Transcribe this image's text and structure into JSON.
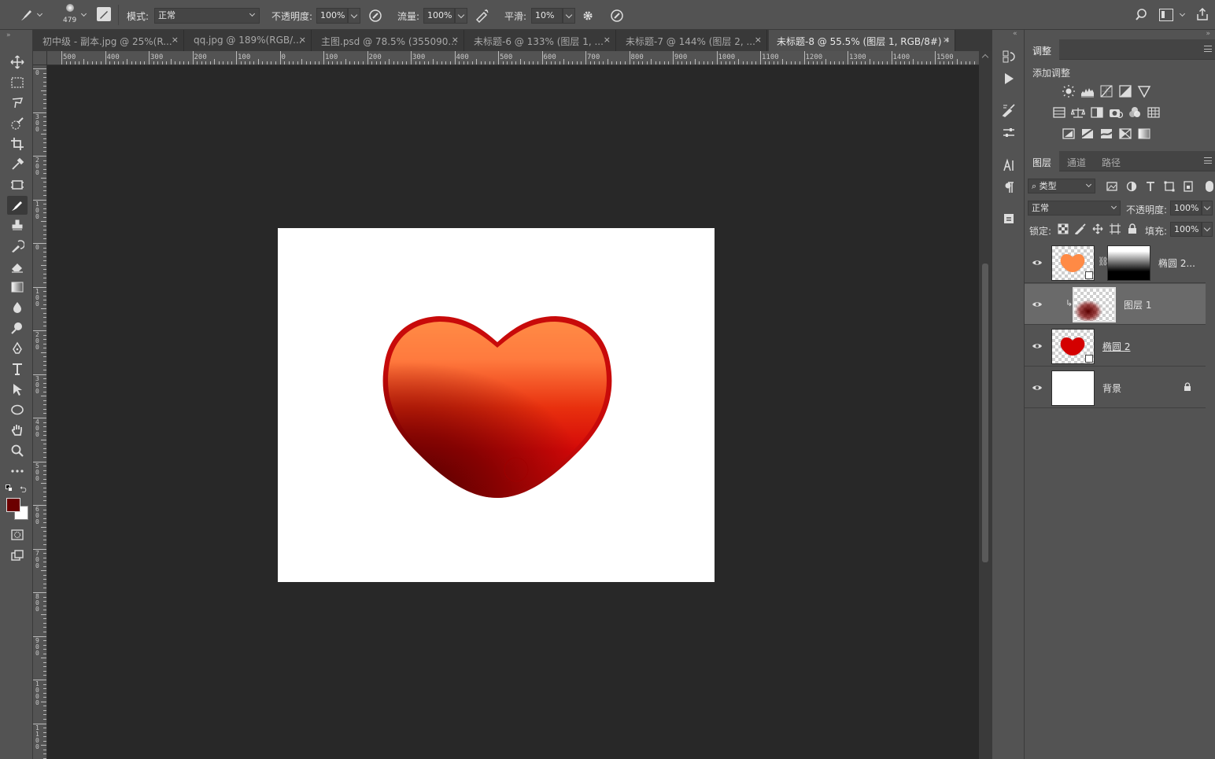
{
  "options_bar": {
    "brush_size": "479",
    "mode_label": "模式:",
    "mode_value": "正常",
    "opacity_label": "不透明度:",
    "opacity_value": "100%",
    "flow_label": "流量:",
    "flow_value": "100%",
    "smoothing_label": "平滑:",
    "smoothing_value": "10%"
  },
  "tabs": [
    {
      "label": "初中级 - 副本.jpg @ 25%(R...",
      "active": false
    },
    {
      "label": "qq.jpg @ 189%(RGB/...",
      "active": false
    },
    {
      "label": "主图.psd @ 78.5% (355090...",
      "active": false
    },
    {
      "label": "未标题-6 @ 133% (图层 1, ...",
      "active": false
    },
    {
      "label": "未标题-7 @ 144% (图层 2, ...",
      "active": false
    },
    {
      "label": "未标题-8 @ 55.5% (图层 1, RGB/8#) *",
      "active": true
    }
  ],
  "tab_close_glyph": "×",
  "ruler": {
    "h_labels": [
      "500",
      "400",
      "300",
      "200",
      "100",
      "0",
      "100",
      "200",
      "300",
      "400",
      "500",
      "600",
      "700",
      "800",
      "900",
      "1000",
      "1100",
      "1200",
      "1300",
      "1400",
      "1500"
    ],
    "v_labels": [
      "0",
      "300",
      "200",
      "100",
      "0",
      "100",
      "200",
      "300",
      "400",
      "500",
      "600",
      "700",
      "800",
      "900",
      "1000",
      "1100"
    ]
  },
  "colors": {
    "foreground": "#6b0000",
    "background": "#ffffff",
    "heart_top": "#ff8a45",
    "heart_mid": "#e8300e",
    "heart_bottom": "#d40808",
    "heart_shadow": "#4a0000",
    "heart_stroke": "#c80a0a"
  },
  "adjustments_panel": {
    "tab_label": "调整",
    "add_label": "添加调整"
  },
  "layers_panel": {
    "tabs": [
      "图层",
      "通道",
      "路径"
    ],
    "filter_kind": "类型",
    "blend_mode": "正常",
    "opacity_label": "不透明度:",
    "opacity_value": "100%",
    "lock_label": "锁定:",
    "fill_label": "填充:",
    "fill_value": "100%",
    "layers": [
      {
        "name": "椭圆 2...",
        "selected": false,
        "thumb": "orange-heart",
        "has_mask": true
      },
      {
        "name": "图层 1",
        "selected": true,
        "thumb": "dark-brush",
        "clipped": true
      },
      {
        "name": "椭圆 2",
        "selected": false,
        "thumb": "red-heart"
      },
      {
        "name": "背景",
        "selected": false,
        "thumb": "white",
        "locked": true
      }
    ]
  }
}
